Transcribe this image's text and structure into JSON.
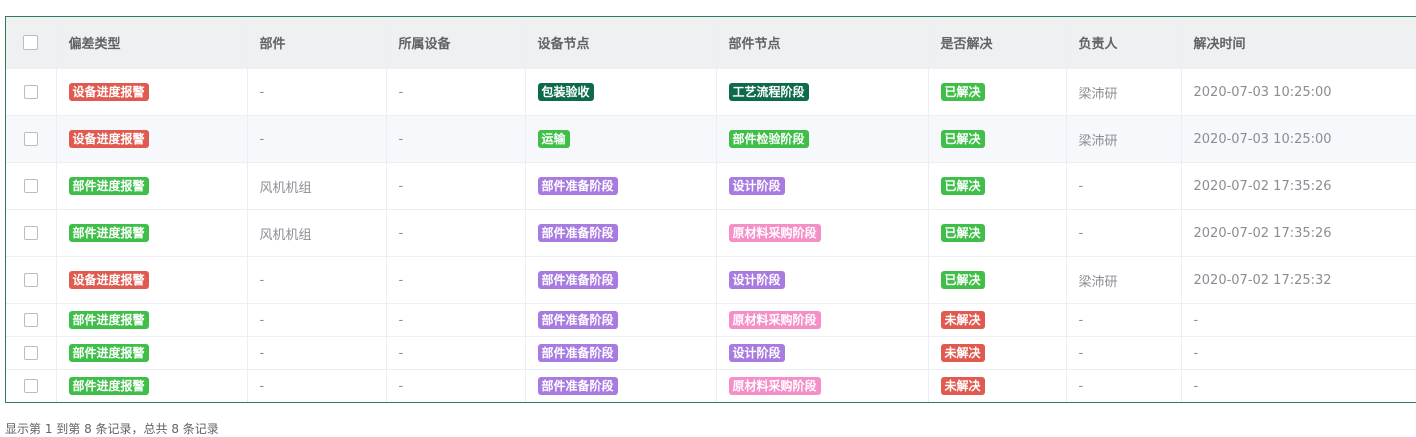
{
  "table": {
    "columns": {
      "deviation_type": "偏差类型",
      "part": "部件",
      "device": "所属设备",
      "device_node": "设备节点",
      "part_node": "部件节点",
      "resolved": "是否解决",
      "owner": "负责人",
      "resolve_time": "解决时间"
    },
    "rows": [
      {
        "deviation_type": "设备进度报警",
        "part": "-",
        "device": "-",
        "device_node": "包装验收",
        "part_node": "工艺流程阶段",
        "resolved": "已解决",
        "owner": "梁沛研",
        "resolve_time": "2020-07-03 10:25:00"
      },
      {
        "deviation_type": "设备进度报警",
        "part": "-",
        "device": "-",
        "device_node": "运输",
        "part_node": "部件检验阶段",
        "resolved": "已解决",
        "owner": "梁沛研",
        "resolve_time": "2020-07-03 10:25:00"
      },
      {
        "deviation_type": "部件进度报警",
        "part": "风机机组",
        "device": "-",
        "device_node": "部件准备阶段",
        "part_node": "设计阶段",
        "resolved": "已解决",
        "owner": "-",
        "resolve_time": "2020-07-02 17:35:26"
      },
      {
        "deviation_type": "部件进度报警",
        "part": "风机机组",
        "device": "-",
        "device_node": "部件准备阶段",
        "part_node": "原材料采购阶段",
        "resolved": "已解决",
        "owner": "-",
        "resolve_time": "2020-07-02 17:35:26"
      },
      {
        "deviation_type": "设备进度报警",
        "part": "-",
        "device": "-",
        "device_node": "部件准备阶段",
        "part_node": "设计阶段",
        "resolved": "已解决",
        "owner": "梁沛研",
        "resolve_time": "2020-07-02 17:25:32"
      },
      {
        "deviation_type": "部件进度报警",
        "part": "-",
        "device": "-",
        "device_node": "部件准备阶段",
        "part_node": "原材料采购阶段",
        "resolved": "未解决",
        "owner": "-",
        "resolve_time": "-"
      },
      {
        "deviation_type": "部件进度报警",
        "part": "-",
        "device": "-",
        "device_node": "部件准备阶段",
        "part_node": "设计阶段",
        "resolved": "未解决",
        "owner": "-",
        "resolve_time": "-"
      },
      {
        "deviation_type": "部件进度报警",
        "part": "-",
        "device": "-",
        "device_node": "部件准备阶段",
        "part_node": "原材料采购阶段",
        "resolved": "未解决",
        "owner": "-",
        "resolve_time": "-"
      }
    ]
  },
  "colors": {
    "tag_red": "#e05a4f",
    "tag_green": "#3fbf4a",
    "tag_darkgreen": "#0e6b4a",
    "tag_purple": "#a77be0",
    "tag_pink": "#f48fc8",
    "table_border": "#2e7d57"
  },
  "footer": {
    "text": "显示第 1 到第 8 条记录，总共 8 条记录"
  }
}
